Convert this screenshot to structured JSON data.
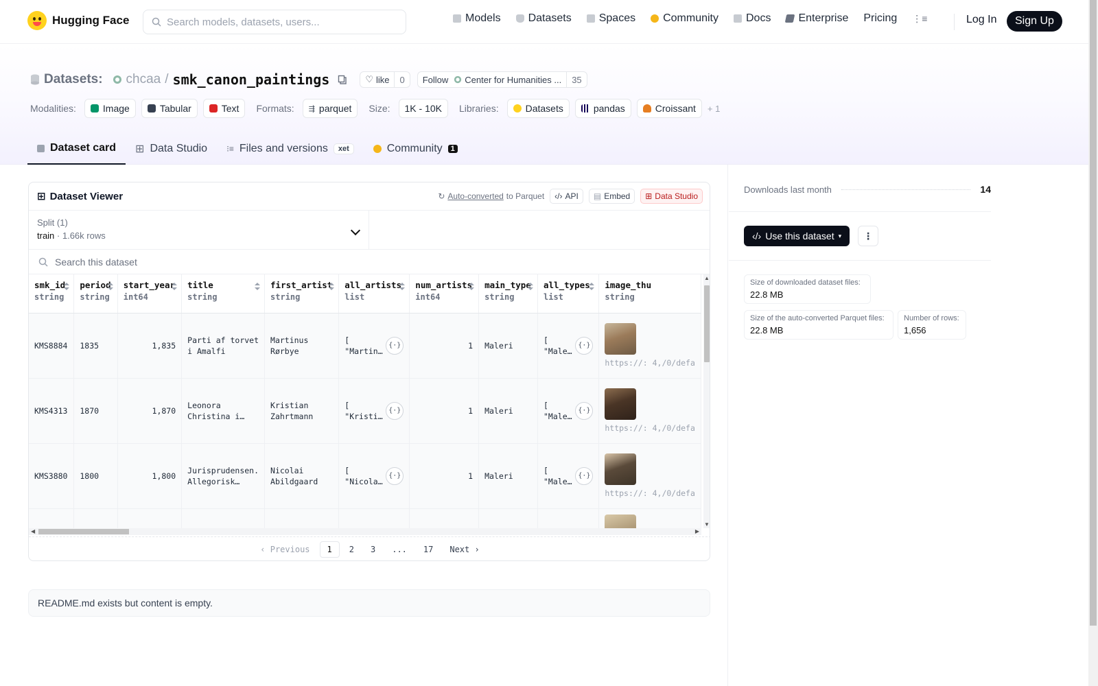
{
  "nav": {
    "logo_text": "Hugging Face",
    "search_placeholder": "Search models, datasets, users...",
    "links": [
      {
        "label": "Models",
        "icon": "models-icon",
        "color": "#9ca3af"
      },
      {
        "label": "Datasets",
        "icon": "datasets-icon",
        "color": "#9ca3af"
      },
      {
        "label": "Spaces",
        "icon": "spaces-icon",
        "color": "#9ca3af"
      },
      {
        "label": "Community",
        "icon": "community-icon",
        "color": "#f5b619"
      },
      {
        "label": "Docs",
        "icon": "docs-icon",
        "color": "#9ca3af"
      },
      {
        "label": "Enterprise",
        "icon": "enterprise-icon",
        "color": "#6b7280"
      },
      {
        "label": "Pricing",
        "icon": "",
        "color": ""
      }
    ],
    "login": "Log In",
    "signup": "Sign Up"
  },
  "header": {
    "datasets_label": "Datasets:",
    "org": "chcaa",
    "separator": "/",
    "name": "smk_canon_paintings",
    "like_label": "like",
    "like_count": "0",
    "follow_label": "Follow",
    "follow_org": "Center for Humanities ...",
    "follow_count": "35",
    "modalities_label": "Modalities:",
    "modalities": [
      {
        "label": "Image",
        "color": "#059669"
      },
      {
        "label": "Tabular",
        "color": "#374151"
      },
      {
        "label": "Text",
        "color": "#dc2626"
      }
    ],
    "formats_label": "Formats:",
    "format": "parquet",
    "size_label": "Size:",
    "size": "1K - 10K",
    "libraries_label": "Libraries:",
    "libraries": [
      {
        "label": "Datasets",
        "color": "#ffd21e"
      },
      {
        "label": "pandas",
        "color": "#150458"
      },
      {
        "label": "Croissant",
        "color": "#e67e22"
      }
    ],
    "libraries_more": "+ 1",
    "tabs": [
      {
        "label": "Dataset card",
        "active": true
      },
      {
        "label": "Data Studio",
        "active": false
      },
      {
        "label": "Files and versions",
        "active": false,
        "badge": "xet"
      },
      {
        "label": "Community",
        "active": false,
        "badge": "1"
      }
    ]
  },
  "viewer": {
    "title": "Dataset Viewer",
    "auto_converted": "Auto-converted",
    "to_parquet": "to Parquet",
    "api": "API",
    "embed": "Embed",
    "data_studio": "Data Studio",
    "split_label": "Split (1)",
    "split_name": "train",
    "split_rows": "1.66k rows",
    "search_placeholder": "Search this dataset",
    "columns": [
      {
        "name": "smk_id",
        "type": "string"
      },
      {
        "name": "period",
        "type": "string"
      },
      {
        "name": "start_year",
        "type": "int64"
      },
      {
        "name": "title",
        "type": "string"
      },
      {
        "name": "first_artist",
        "type": "string"
      },
      {
        "name": "all_artists",
        "type": "list"
      },
      {
        "name": "num_artists",
        "type": "int64"
      },
      {
        "name": "main_type",
        "type": "string"
      },
      {
        "name": "all_types",
        "type": "list"
      },
      {
        "name": "image_thu",
        "type": "string"
      }
    ],
    "rows": [
      {
        "smk_id": "KMS8884",
        "period": "1835",
        "start_year": "1,835",
        "title": "Parti af torvet\ni Amalfi",
        "first_artist": "Martinus\nRørbye",
        "all_artists": "[\n\"Martin…",
        "num_artists": "1",
        "main_type": "Maleri",
        "all_types": "[\n\"Male…",
        "image_url": "https://:\n4,/0/defa",
        "thumb_colors": [
          "#9b7b5a",
          "#c7b79b",
          "#6e5b45"
        ]
      },
      {
        "smk_id": "KMS4313",
        "period": "1870",
        "start_year": "1,870",
        "title": "Leonora\nChristina i…",
        "first_artist": "Kristian\nZahrtmann",
        "all_artists": "[\n\"Kristi…",
        "num_artists": "1",
        "main_type": "Maleri",
        "all_types": "[\n\"Male…",
        "image_url": "https://:\n4,/0/defa",
        "thumb_colors": [
          "#4a3526",
          "#8c6d4f",
          "#2f221a"
        ]
      },
      {
        "smk_id": "KMS3880",
        "period": "1800",
        "start_year": "1,800",
        "title": "Jurisprudensen.\nAllegorisk…",
        "first_artist": "Nicolai\nAbildgaard",
        "all_artists": "[\n\"Nicola…",
        "num_artists": "1",
        "main_type": "Maleri",
        "all_types": "[\n\"Male…",
        "image_url": "https://:\n4,/0/defa",
        "thumb_colors": [
          "#5a4a3a",
          "#d8c4a8",
          "#3e3428"
        ]
      }
    ],
    "pagination": {
      "previous": "Previous",
      "pages": [
        "1",
        "2",
        "3",
        "...",
        "17"
      ],
      "current": "1",
      "next": "Next"
    }
  },
  "readme_notice": "README.md exists but content is empty.",
  "sidebar": {
    "downloads_label": "Downloads last month",
    "downloads_value": "14",
    "use_button": "Use this dataset",
    "stats": [
      {
        "label": "Size of downloaded dataset files:",
        "value": "22.8 MB"
      },
      {
        "label": "Size of the auto-converted Parquet files:",
        "value": "22.8 MB"
      },
      {
        "label": "Number of rows:",
        "value": "1,656"
      }
    ]
  }
}
